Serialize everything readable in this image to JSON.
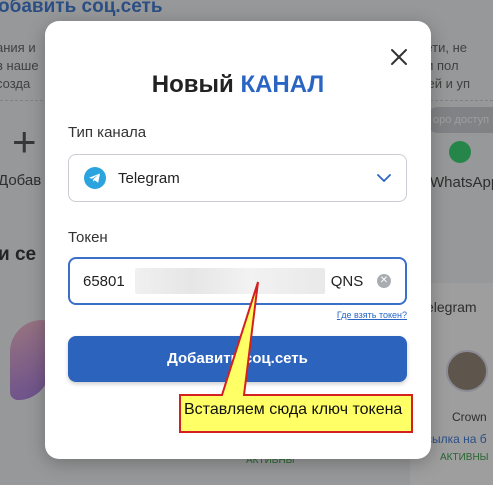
{
  "background": {
    "title_fragment": "обавить соц.сеть",
    "text_lines_left": [
      "ания и",
      "в наше",
      "созда"
    ],
    "text_lines_right": [
      "й сети, не",
      "ей и пол",
      "остей и уп"
    ],
    "add_label": "Добав",
    "section_title": "и се",
    "pill": "оро доступ",
    "whatsapp_label": "WhatsApp",
    "card_title": "elegram",
    "card_name": "Crown",
    "card_link": "сылка на б",
    "card_status": "АКТИВНЫ",
    "card_status2": "АКТИВНЫ"
  },
  "modal": {
    "title_part1": "Новый",
    "title_part2": "КАНАЛ",
    "channel_type_label": "Тип канала",
    "channel_type_value": "Telegram",
    "token_label": "Токен",
    "token_value_start": "65801",
    "token_value_end": "QNS",
    "help_link": "Где взять токен?",
    "submit_label": "Добавить соц.сеть"
  },
  "annotation": {
    "text": "Вставляем сюда ключ токена"
  },
  "colors": {
    "accent": "#2b65c4",
    "button": "#2c63bd",
    "callout_fill": "#ffff66",
    "callout_stroke": "#d42020",
    "telegram": "#2aa3de",
    "whatsapp": "#25d366"
  }
}
